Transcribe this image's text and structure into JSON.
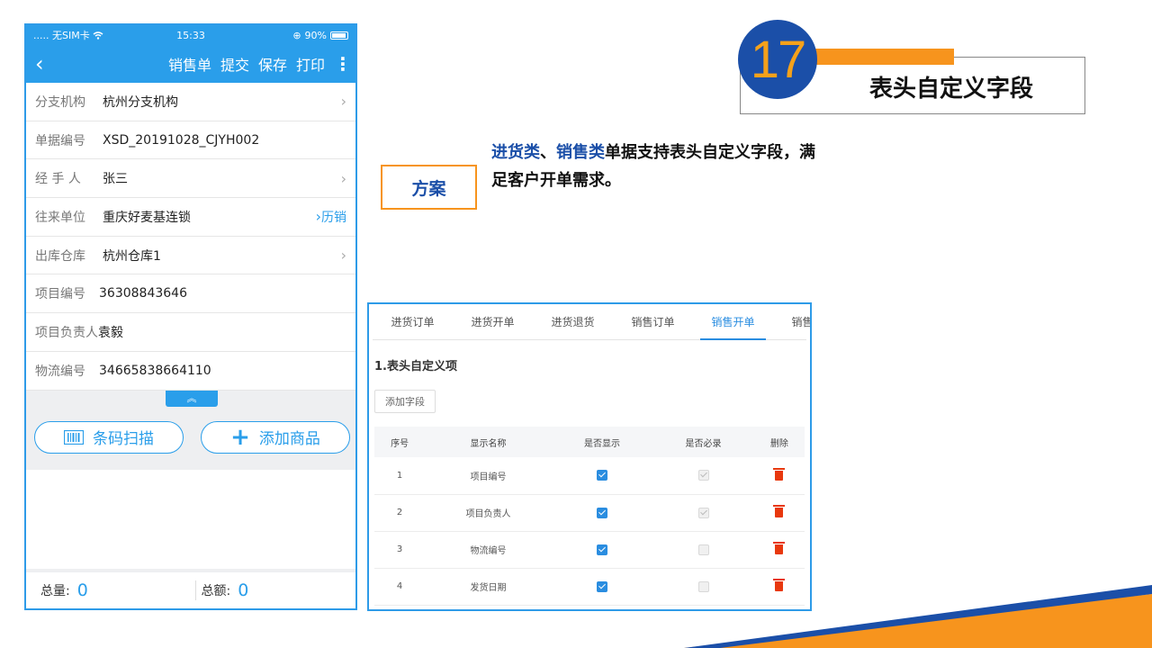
{
  "phone": {
    "status": {
      "carrier": "..... 无SIM卡",
      "time": "15:33",
      "battery": "90%"
    },
    "nav": {
      "actions": [
        "销售单",
        "提交",
        "保存",
        "打印"
      ]
    },
    "fields": [
      {
        "label": "分支机构",
        "value": "杭州分支机构",
        "chevron": true
      },
      {
        "label": "单据编号",
        "value": "XSD_20191028_CJYH002",
        "chevron": false
      },
      {
        "label": "经 手 人",
        "value": "张三",
        "chevron": true
      },
      {
        "label": "往来单位",
        "value": "重庆好麦基连锁",
        "chevron": true,
        "extra": "历销"
      },
      {
        "label": "出库仓库",
        "value": "杭州仓库1",
        "chevron": true
      },
      {
        "label": "项目编号",
        "value": "36308843646",
        "chevron": false
      },
      {
        "label": "项目负责人",
        "value": "袁毅",
        "chevron": false
      },
      {
        "label": "物流编号",
        "value": "34665838664110",
        "chevron": false
      }
    ],
    "buttons": {
      "scan": "条码扫描",
      "add": "添加商品"
    },
    "totals": {
      "qty_label": "总量:",
      "qty": "0",
      "amount_label": "总额:",
      "amount": "0"
    }
  },
  "slide": {
    "number": "17",
    "title": "表头自定义字段",
    "plan_label": "方案",
    "desc_hl1": "进货类",
    "desc_sep": "、",
    "desc_hl2": "销售类",
    "desc_rest": "单据支持表头自定义字段，满足客户开单需求。"
  },
  "web": {
    "tabs": [
      "进货订单",
      "进货开单",
      "进货退货",
      "销售订单",
      "销售开单",
      "销售退货"
    ],
    "active_tab": "销售开单",
    "section_title": "1.表头自定义项",
    "add_button": "添加字段",
    "columns": [
      "序号",
      "显示名称",
      "是否显示",
      "是否必录",
      "删除"
    ],
    "rows": [
      {
        "no": "1",
        "name": "项目编号",
        "show": true,
        "required": true
      },
      {
        "no": "2",
        "name": "项目负责人",
        "show": true,
        "required": true
      },
      {
        "no": "3",
        "name": "物流编号",
        "show": true,
        "required": false
      },
      {
        "no": "4",
        "name": "发货日期",
        "show": true,
        "required": false
      }
    ]
  },
  "colors": {
    "accent_blue": "#2a9eea",
    "brand_blue": "#1b4fa8",
    "orange": "#f7941d",
    "delete_red": "#e8380d"
  }
}
